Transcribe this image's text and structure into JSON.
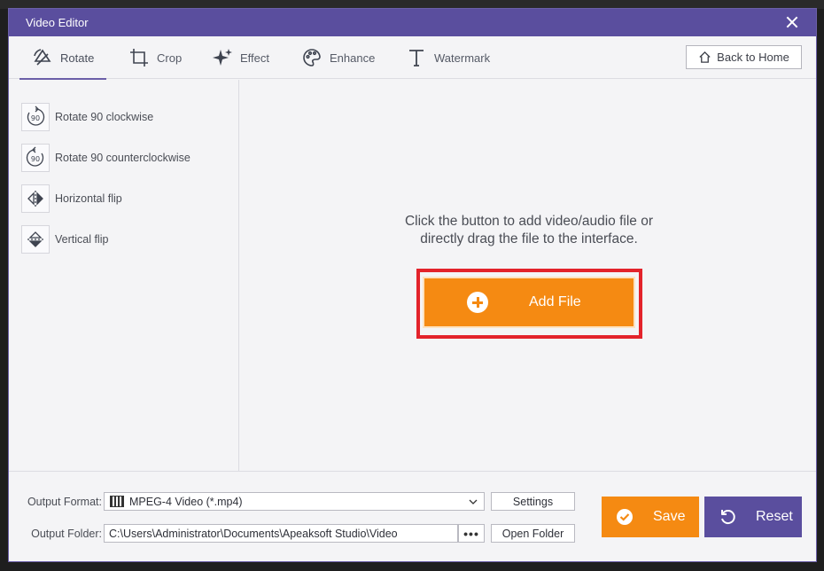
{
  "window": {
    "title": "Video Editor"
  },
  "tabs": [
    {
      "label": "Rotate",
      "icon": "rotate-icon",
      "active": true
    },
    {
      "label": "Crop",
      "icon": "crop-icon"
    },
    {
      "label": "Effect",
      "icon": "sparkle-icon"
    },
    {
      "label": "Enhance",
      "icon": "palette-icon"
    },
    {
      "label": "Watermark",
      "icon": "text-t-icon"
    }
  ],
  "header": {
    "back_home_label": "Back to Home"
  },
  "sidebar": {
    "items": [
      {
        "label": "Rotate 90 clockwise",
        "icon": "rotate-clockwise-icon"
      },
      {
        "label": "Rotate 90 counterclockwise",
        "icon": "rotate-counterclockwise-icon"
      },
      {
        "label": "Horizontal flip",
        "icon": "flip-horizontal-icon"
      },
      {
        "label": "Vertical flip",
        "icon": "flip-vertical-icon"
      }
    ]
  },
  "main": {
    "hint_line1": "Click the button to add video/audio file or",
    "hint_line2": "directly drag the file to the interface.",
    "add_file_label": "Add File"
  },
  "output": {
    "format_label": "Output Format:",
    "format_value": "MPEG-4 Video (*.mp4)",
    "settings_label": "Settings",
    "folder_label": "Output Folder:",
    "folder_value": "C:\\Users\\Administrator\\Documents\\Apeaksoft Studio\\Video",
    "browse_label": "•••",
    "open_folder_label": "Open Folder"
  },
  "actions": {
    "save_label": "Save",
    "reset_label": "Reset"
  },
  "colors": {
    "accent_purple": "#5a4e9e",
    "accent_orange": "#f58a12",
    "highlight_red": "#e3232b"
  }
}
